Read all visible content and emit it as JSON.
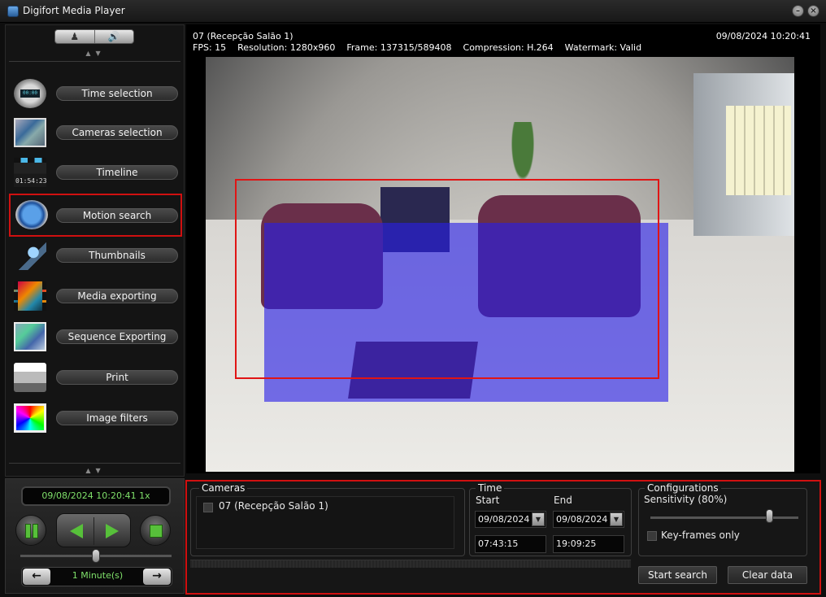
{
  "window": {
    "title": "Digifort Media Player"
  },
  "sidebar": {
    "items": [
      {
        "label": "Time selection",
        "icon": "stopwatch-icon"
      },
      {
        "label": "Cameras selection",
        "icon": "cameras-icon"
      },
      {
        "label": "Timeline",
        "icon": "timeline-icon"
      },
      {
        "label": "Motion search",
        "icon": "motion-search-icon"
      },
      {
        "label": "Thumbnails",
        "icon": "thumbnails-icon"
      },
      {
        "label": "Media exporting",
        "icon": "film-export-icon"
      },
      {
        "label": "Sequence Exporting",
        "icon": "sequence-export-icon"
      },
      {
        "label": "Print",
        "icon": "printer-icon"
      },
      {
        "label": "Image filters",
        "icon": "image-filters-icon"
      }
    ],
    "active_index": 3
  },
  "video": {
    "camera_title": "07 (Recepção Salão 1)",
    "timestamp": "09/08/2024 10:20:41",
    "fps": "FPS: 15",
    "resolution": "Resolution: 1280x960",
    "frame": "Frame: 137315/589408",
    "compression": "Compression: H.264",
    "watermark": "Watermark: Valid"
  },
  "playback": {
    "datetime": "09/08/2024 10:20:41 1x",
    "step_label": "1 Minute(s)",
    "position_fraction": 0.5,
    "colors": {
      "accent": "#57c03a",
      "display_text": "#7fe06a"
    }
  },
  "search": {
    "cameras_title": "Cameras",
    "cameras": [
      {
        "label": "07 (Recepção Salão 1)",
        "checked": false
      }
    ],
    "time_title": "Time",
    "start_label": "Start",
    "end_label": "End",
    "start_date": "09/08/2024",
    "end_date": "09/08/2024",
    "start_time": "07:43:15",
    "end_time": "19:09:25",
    "config_title": "Configurations",
    "sensitivity_label": "Sensitivity (80%)",
    "sensitivity_value": 80,
    "keyframes_label": "Key-frames only",
    "keyframes_checked": false,
    "start_button": "Start search",
    "clear_button": "Clear data",
    "colors": {
      "highlight_border": "#d01010",
      "motion_mask": "#281ee6"
    }
  }
}
